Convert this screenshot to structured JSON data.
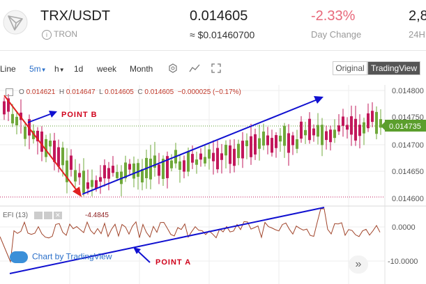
{
  "header": {
    "pair": "TRX/USDT",
    "network": "TRON",
    "price": "0.014605",
    "usd_price": "≈ $0.01460700",
    "change": "-2.33%",
    "change_label": "Day Change",
    "volume_partial": "2,8",
    "volume_label": "24H"
  },
  "toolbar": {
    "items": [
      "Line",
      "5m",
      "h",
      "1d",
      "week",
      "Month"
    ],
    "selected": "5m",
    "view_original": "Original",
    "view_tradingview": "TradingView"
  },
  "ohlc": {
    "o_label": "O",
    "o": "0.014621",
    "h_label": "H",
    "h": "0.014647",
    "l_label": "L",
    "l": "0.014605",
    "c_label": "C",
    "c": "0.014605",
    "change": "−0.000025 (−0.17%)"
  },
  "price_axis": {
    "ticks": [
      "0.014800",
      "0.014750",
      "0.014700",
      "0.014650",
      "0.014600"
    ],
    "current": "0.014735"
  },
  "efi": {
    "label": "EFI (13)",
    "value": "-4.4845",
    "ticks": [
      "0.0000",
      "-10.0000"
    ]
  },
  "annotations": {
    "point_b": "POINT B",
    "point_a": "POINT A"
  },
  "credit": "Chart by TradingView",
  "colors": {
    "up": "#6fa83a",
    "down": "#c2185b",
    "arrow_red": "#e02020",
    "arrow_blue": "#1010d0",
    "current_badge": "#5b9e2d"
  }
}
